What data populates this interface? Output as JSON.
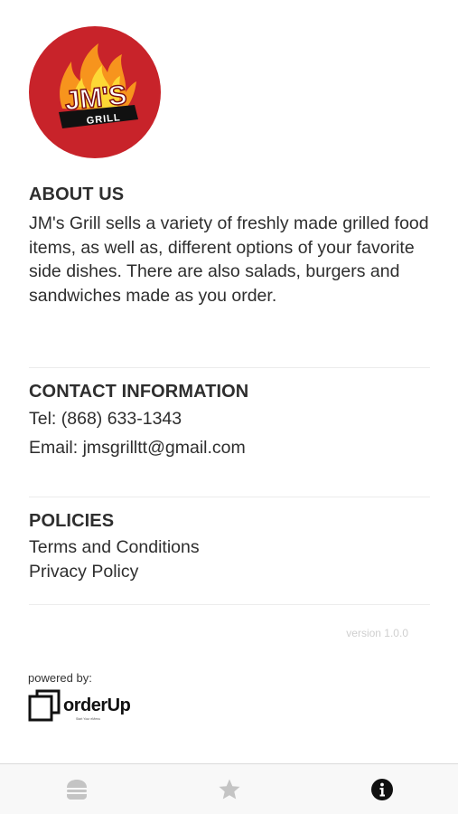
{
  "logo": {
    "main_text": "JM'S",
    "sub_text": "GRILL",
    "colors": {
      "circle": "#c8232a",
      "flame": "#f7941d",
      "flame_inner": "#fdd835",
      "banner": "#111111"
    }
  },
  "about": {
    "heading": "ABOUT US",
    "text": "JM's Grill sells a variety of freshly made grilled food items, as well as, different options of your favorite side dishes. There are also salads, burgers and sandwiches made as you order."
  },
  "contact": {
    "heading": "CONTACT INFORMATION",
    "tel": "Tel: (868) 633-1343",
    "email": "Email: jmsgrilltt@gmail.com"
  },
  "policies": {
    "heading": "POLICIES",
    "terms": "Terms and Conditions",
    "privacy": "Privacy Policy"
  },
  "version": "version 1.0.0",
  "footer": {
    "powered_by": "powered by:",
    "brand_name": "orderUp",
    "brand_tagline": "Start Your eMenu"
  },
  "tabbar": {
    "items": [
      {
        "icon": "burger-icon",
        "active": false
      },
      {
        "icon": "star-icon",
        "active": false
      },
      {
        "icon": "info-icon",
        "active": true
      }
    ],
    "colors": {
      "active": "#111111",
      "inactive": "#c4c4c4"
    }
  }
}
